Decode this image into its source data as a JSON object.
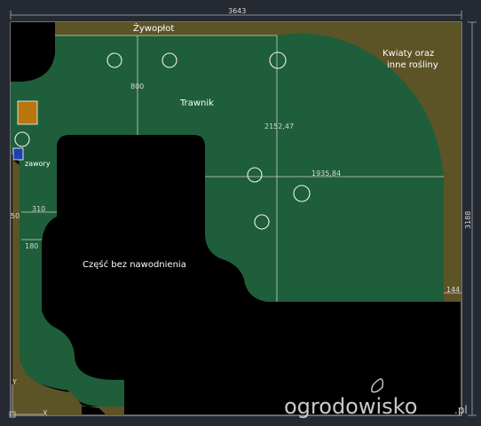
{
  "labels": {
    "hedge": "Żywopłot",
    "flowers_line1": "Kwiaty oraz",
    "flowers_line2": "inne rośliny",
    "lawn": "Trawnik",
    "valves": "zawory",
    "no_irrigation": "Część bez nawodnienia"
  },
  "dimensions": {
    "total_width": "3643",
    "total_height": "3188",
    "d_800": "800",
    "d_2152": "2152,47",
    "d_1935": "1935,84",
    "d_310": "310",
    "d_180": "180",
    "d_50": "50",
    "d_144": "144"
  },
  "axis": {
    "x": "X",
    "y": "Y"
  },
  "watermark": {
    "brand": "ogrodowisko",
    "suffix": ".pl"
  },
  "colors": {
    "lawn": "#1e5e3a",
    "flowers": "#5c5426",
    "hedge": "#5c5426",
    "background": "#252a32",
    "dead_zone": "#000000",
    "valve_box": "#1f3fb0",
    "device_box": "#b8760e"
  },
  "icons": [
    "sprinkler-head-icon",
    "valve-box-icon",
    "leaf-icon"
  ]
}
